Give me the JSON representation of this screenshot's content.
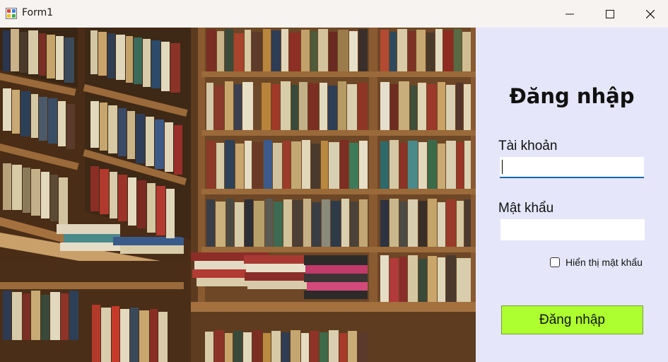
{
  "window": {
    "title": "Form1",
    "icon": "winforms-app-icon",
    "controls": [
      "minimize-icon",
      "maximize-icon",
      "close-icon"
    ]
  },
  "image": {
    "subject": "library bookshelves photo",
    "colors": {
      "wood": "#6a4424",
      "wood_dark": "#4a2d16"
    }
  },
  "login": {
    "heading": "Đăng nhập",
    "username_label": "Tài khoản",
    "username_value": "",
    "password_label": "Mật khẩu",
    "password_value": "",
    "show_password_label": "Hiển thị mật khẩu",
    "show_password_checked": false,
    "submit_label": "Đăng nhập",
    "colors": {
      "panel_bg": "#e6e6fa",
      "button_bg": "#adff2f",
      "focus_underline": "#0066b4"
    }
  }
}
